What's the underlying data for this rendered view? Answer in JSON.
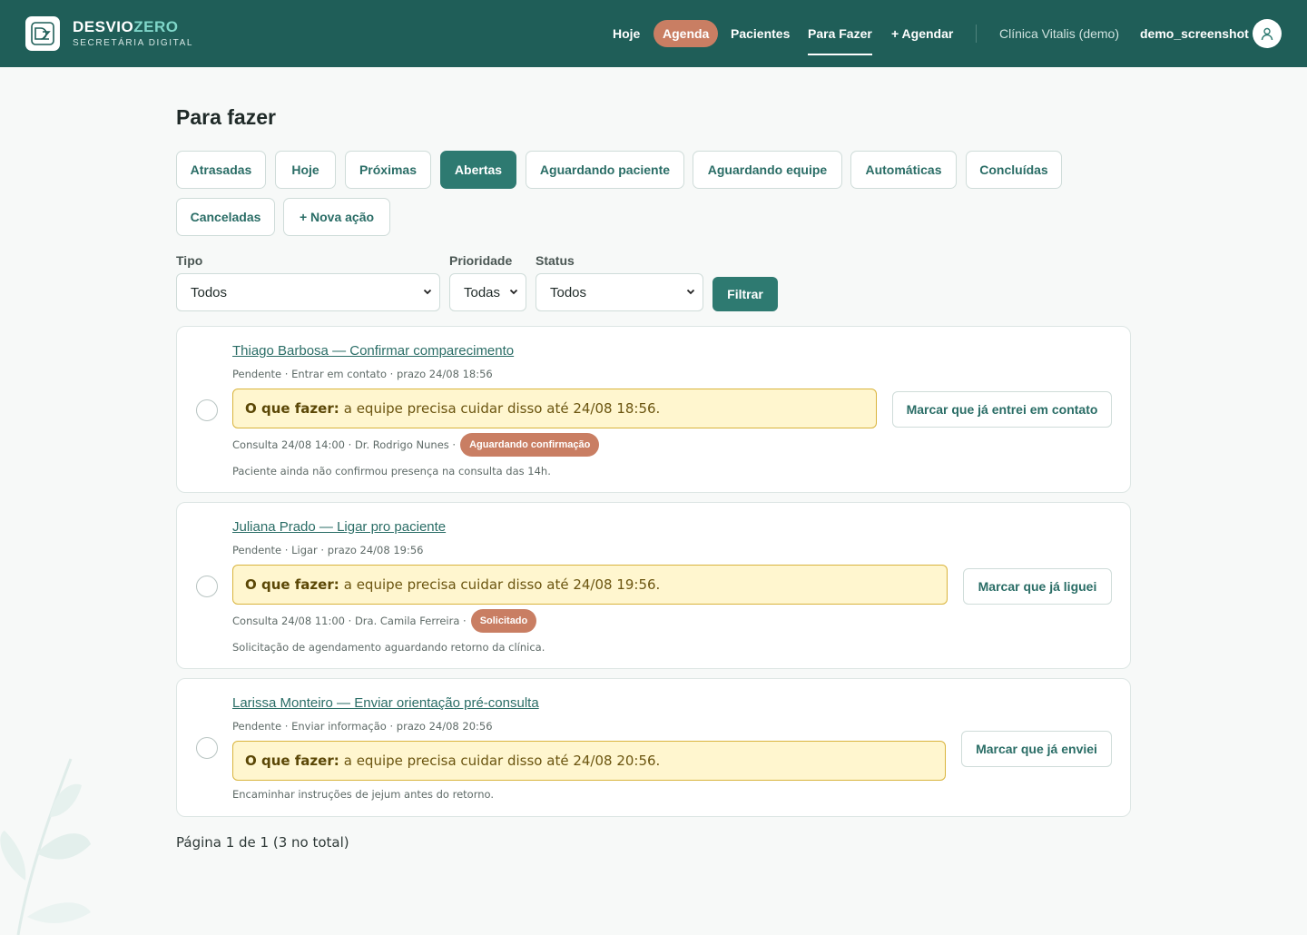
{
  "header": {
    "brand_part1": "DESVIO",
    "brand_part2": "ZERO",
    "brand_subtitle": "SECRETÁRIA DIGITAL",
    "nav": [
      {
        "label": "Hoje"
      },
      {
        "label": "Agenda"
      },
      {
        "label": "Pacientes"
      },
      {
        "label": "Para Fazer"
      },
      {
        "label": "+ Agendar"
      }
    ],
    "clinic": "Clínica Vitalis (demo)",
    "user": "demo_screenshot"
  },
  "page": {
    "title": "Para fazer",
    "tabs": [
      {
        "label": "Atrasadas"
      },
      {
        "label": "Hoje"
      },
      {
        "label": "Próximas"
      },
      {
        "label": "Abertas"
      },
      {
        "label": "Aguardando paciente"
      },
      {
        "label": "Aguardando equipe"
      },
      {
        "label": "Automáticas"
      },
      {
        "label": "Concluídas"
      },
      {
        "label": "Canceladas"
      },
      {
        "label": "+ Nova ação"
      }
    ],
    "active_tab": "Abertas"
  },
  "filters": {
    "tipo_label": "Tipo",
    "tipo_value": "Todos",
    "prioridade_label": "Prioridade",
    "prioridade_value": "Todas",
    "status_label": "Status",
    "status_value": "Todos",
    "submit_label": "Filtrar"
  },
  "tasks": [
    {
      "title": "Thiago Barbosa — Confirmar comparecimento",
      "meta": "Pendente · Entrar em contato · prazo 24/08 18:56",
      "todo_label": "O que fazer:",
      "todo_text": "a equipe precisa cuidar disso até 24/08 18:56.",
      "appointment": "Consulta 24/08 14:00 · Dr. Rodrigo Nunes ·",
      "badge": "Aguardando confirmação",
      "note": "Paciente ainda não confirmou presença na consulta das 14h.",
      "action": "Marcar que já entrei em contato"
    },
    {
      "title": "Juliana Prado — Ligar pro paciente",
      "meta": "Pendente · Ligar · prazo 24/08 19:56",
      "todo_label": "O que fazer:",
      "todo_text": "a equipe precisa cuidar disso até 24/08 19:56.",
      "appointment": "Consulta 24/08 11:00 · Dra. Camila Ferreira ·",
      "badge": "Solicitado",
      "note": "Solicitação de agendamento aguardando retorno da clínica.",
      "action": "Marcar que já liguei"
    },
    {
      "title": "Larissa Monteiro — Enviar orientação pré-consulta",
      "meta": "Pendente · Enviar informação · prazo 24/08 20:56",
      "todo_label": "O que fazer:",
      "todo_text": "a equipe precisa cuidar disso até 24/08 20:56.",
      "note": "Encaminhar instruções de jejum antes do retorno.",
      "action": "Marcar que já enviei"
    }
  ],
  "pagination": "Página 1 de 1 (3 no total)",
  "colors": {
    "header_bg": "#1f5e58",
    "accent": "#2e7a71",
    "badge": "#c97e63",
    "todo_bg": "#fff6cf"
  },
  "icons": [
    "logo-icon",
    "user-icon",
    "chevron-down-icon",
    "leaf-decoration"
  ]
}
